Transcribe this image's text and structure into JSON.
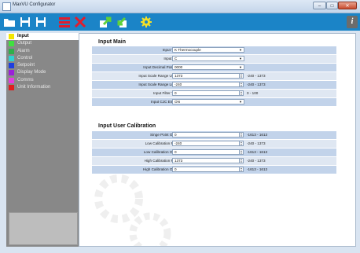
{
  "window": {
    "title": "MaxVU Configurator"
  },
  "window_buttons": {
    "minimize": "–",
    "maximize": "□",
    "close": "✕"
  },
  "toolbar": {
    "icons": [
      "folder-open-icon",
      "save-icon",
      "save-as-icon",
      "list-icon",
      "delete-icon",
      "upload-icon",
      "download-icon",
      "settings-gear-icon",
      "info-icon"
    ],
    "info_label": "i"
  },
  "sidebar": {
    "items": [
      {
        "label": "Input",
        "color": "#f3e600",
        "active": true
      },
      {
        "label": "Output",
        "color": "#3fe13f"
      },
      {
        "label": "Alarm",
        "color": "#2fb04b"
      },
      {
        "label": "Control",
        "color": "#2fd2d2"
      },
      {
        "label": "Setpoint",
        "color": "#1e3fe0"
      },
      {
        "label": "Display Mode",
        "color": "#9b20d9"
      },
      {
        "label": "Comms",
        "color": "#e23de0"
      },
      {
        "label": "Unit Information",
        "color": "#e01e1e"
      }
    ]
  },
  "input_main": {
    "title": "Input Main",
    "rows": [
      {
        "label": "Input Type",
        "value": "K Thermocouple",
        "kind": "select",
        "range": ""
      },
      {
        "label": "Input Unit",
        "value": "C",
        "kind": "select",
        "range": ""
      },
      {
        "label": "Input Decimal Position",
        "value": "0000",
        "kind": "select",
        "range": ""
      },
      {
        "label": "Input Scale Range Upper",
        "value": "1373",
        "kind": "number",
        "range": "-240 - 1373"
      },
      {
        "label": "Input Scale Range Lower",
        "value": "-240",
        "kind": "number",
        "range": "-240 - 1373"
      },
      {
        "label": "Input Filter Time",
        "value": "0",
        "kind": "number",
        "range": "0 - 100"
      },
      {
        "label": "Input CJC Enable",
        "value": "ON",
        "kind": "select",
        "range": ""
      }
    ]
  },
  "input_user_calibration": {
    "title": "Input User Calibration",
    "rows": [
      {
        "label": "Singe Point Offset",
        "value": "0",
        "range": "-1613 - 1613"
      },
      {
        "label": "Low Calibration Point",
        "value": "-240",
        "range": "-240 - 1373"
      },
      {
        "label": "Low Calibration Offset",
        "value": "0",
        "range": "-1613 - 1613"
      },
      {
        "label": "High Calibration Point",
        "value": "1373",
        "range": "-240 - 1373"
      },
      {
        "label": "High Calibration Offset",
        "value": "0",
        "range": "-1613 - 1613"
      }
    ]
  }
}
